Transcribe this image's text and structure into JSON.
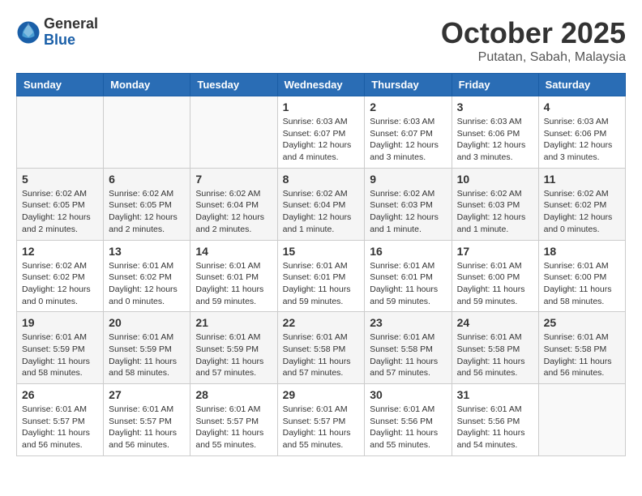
{
  "header": {
    "logo_general": "General",
    "logo_blue": "Blue",
    "month_title": "October 2025",
    "location": "Putatan, Sabah, Malaysia"
  },
  "days_of_week": [
    "Sunday",
    "Monday",
    "Tuesday",
    "Wednesday",
    "Thursday",
    "Friday",
    "Saturday"
  ],
  "weeks": [
    [
      {
        "day": "",
        "info": ""
      },
      {
        "day": "",
        "info": ""
      },
      {
        "day": "",
        "info": ""
      },
      {
        "day": "1",
        "info": "Sunrise: 6:03 AM\nSunset: 6:07 PM\nDaylight: 12 hours\nand 4 minutes."
      },
      {
        "day": "2",
        "info": "Sunrise: 6:03 AM\nSunset: 6:07 PM\nDaylight: 12 hours\nand 3 minutes."
      },
      {
        "day": "3",
        "info": "Sunrise: 6:03 AM\nSunset: 6:06 PM\nDaylight: 12 hours\nand 3 minutes."
      },
      {
        "day": "4",
        "info": "Sunrise: 6:03 AM\nSunset: 6:06 PM\nDaylight: 12 hours\nand 3 minutes."
      }
    ],
    [
      {
        "day": "5",
        "info": "Sunrise: 6:02 AM\nSunset: 6:05 PM\nDaylight: 12 hours\nand 2 minutes."
      },
      {
        "day": "6",
        "info": "Sunrise: 6:02 AM\nSunset: 6:05 PM\nDaylight: 12 hours\nand 2 minutes."
      },
      {
        "day": "7",
        "info": "Sunrise: 6:02 AM\nSunset: 6:04 PM\nDaylight: 12 hours\nand 2 minutes."
      },
      {
        "day": "8",
        "info": "Sunrise: 6:02 AM\nSunset: 6:04 PM\nDaylight: 12 hours\nand 1 minute."
      },
      {
        "day": "9",
        "info": "Sunrise: 6:02 AM\nSunset: 6:03 PM\nDaylight: 12 hours\nand 1 minute."
      },
      {
        "day": "10",
        "info": "Sunrise: 6:02 AM\nSunset: 6:03 PM\nDaylight: 12 hours\nand 1 minute."
      },
      {
        "day": "11",
        "info": "Sunrise: 6:02 AM\nSunset: 6:02 PM\nDaylight: 12 hours\nand 0 minutes."
      }
    ],
    [
      {
        "day": "12",
        "info": "Sunrise: 6:02 AM\nSunset: 6:02 PM\nDaylight: 12 hours\nand 0 minutes."
      },
      {
        "day": "13",
        "info": "Sunrise: 6:01 AM\nSunset: 6:02 PM\nDaylight: 12 hours\nand 0 minutes."
      },
      {
        "day": "14",
        "info": "Sunrise: 6:01 AM\nSunset: 6:01 PM\nDaylight: 11 hours\nand 59 minutes."
      },
      {
        "day": "15",
        "info": "Sunrise: 6:01 AM\nSunset: 6:01 PM\nDaylight: 11 hours\nand 59 minutes."
      },
      {
        "day": "16",
        "info": "Sunrise: 6:01 AM\nSunset: 6:01 PM\nDaylight: 11 hours\nand 59 minutes."
      },
      {
        "day": "17",
        "info": "Sunrise: 6:01 AM\nSunset: 6:00 PM\nDaylight: 11 hours\nand 59 minutes."
      },
      {
        "day": "18",
        "info": "Sunrise: 6:01 AM\nSunset: 6:00 PM\nDaylight: 11 hours\nand 58 minutes."
      }
    ],
    [
      {
        "day": "19",
        "info": "Sunrise: 6:01 AM\nSunset: 5:59 PM\nDaylight: 11 hours\nand 58 minutes."
      },
      {
        "day": "20",
        "info": "Sunrise: 6:01 AM\nSunset: 5:59 PM\nDaylight: 11 hours\nand 58 minutes."
      },
      {
        "day": "21",
        "info": "Sunrise: 6:01 AM\nSunset: 5:59 PM\nDaylight: 11 hours\nand 57 minutes."
      },
      {
        "day": "22",
        "info": "Sunrise: 6:01 AM\nSunset: 5:58 PM\nDaylight: 11 hours\nand 57 minutes."
      },
      {
        "day": "23",
        "info": "Sunrise: 6:01 AM\nSunset: 5:58 PM\nDaylight: 11 hours\nand 57 minutes."
      },
      {
        "day": "24",
        "info": "Sunrise: 6:01 AM\nSunset: 5:58 PM\nDaylight: 11 hours\nand 56 minutes."
      },
      {
        "day": "25",
        "info": "Sunrise: 6:01 AM\nSunset: 5:58 PM\nDaylight: 11 hours\nand 56 minutes."
      }
    ],
    [
      {
        "day": "26",
        "info": "Sunrise: 6:01 AM\nSunset: 5:57 PM\nDaylight: 11 hours\nand 56 minutes."
      },
      {
        "day": "27",
        "info": "Sunrise: 6:01 AM\nSunset: 5:57 PM\nDaylight: 11 hours\nand 56 minutes."
      },
      {
        "day": "28",
        "info": "Sunrise: 6:01 AM\nSunset: 5:57 PM\nDaylight: 11 hours\nand 55 minutes."
      },
      {
        "day": "29",
        "info": "Sunrise: 6:01 AM\nSunset: 5:57 PM\nDaylight: 11 hours\nand 55 minutes."
      },
      {
        "day": "30",
        "info": "Sunrise: 6:01 AM\nSunset: 5:56 PM\nDaylight: 11 hours\nand 55 minutes."
      },
      {
        "day": "31",
        "info": "Sunrise: 6:01 AM\nSunset: 5:56 PM\nDaylight: 11 hours\nand 54 minutes."
      },
      {
        "day": "",
        "info": ""
      }
    ]
  ]
}
